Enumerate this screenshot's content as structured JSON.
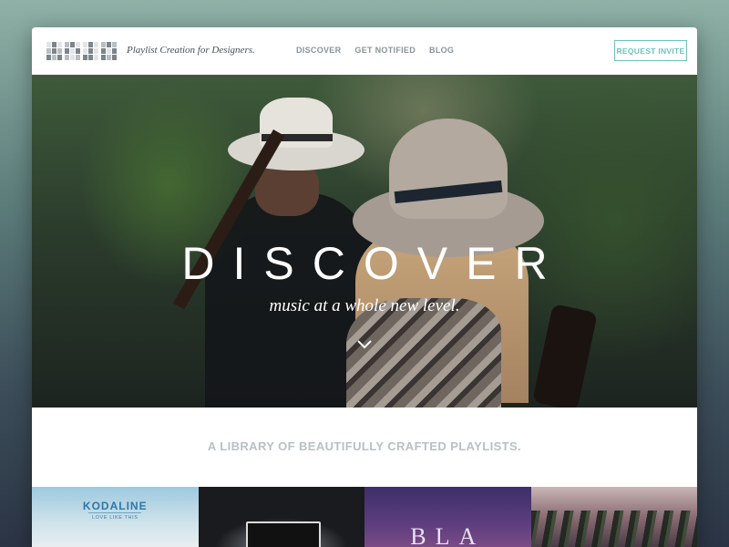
{
  "app": {
    "tagline": "Playlist Creation for Designers."
  },
  "nav": {
    "items": [
      "DISCOVER",
      "GET NOTIFIED",
      "BLOG"
    ],
    "cta_label": "REQUEST INVITE"
  },
  "hero": {
    "title": "DISCOVER",
    "subtitle": "music at a whole new level."
  },
  "section": {
    "heading": "A LIBRARY OF BEAUTIFULLY CRAFTED PLAYLISTS."
  },
  "playlists": [
    {
      "title": "KODALINE",
      "subtitle": "LOVE LIKE THIS"
    },
    {
      "title": ""
    },
    {
      "title": "BLA"
    },
    {
      "title": ""
    }
  ],
  "colors": {
    "accent": "#6cc3bf",
    "nav_text": "#8a939a",
    "heading_text": "#b8c0c6"
  },
  "icons": [
    "logo-mark",
    "chevron-down-icon"
  ]
}
